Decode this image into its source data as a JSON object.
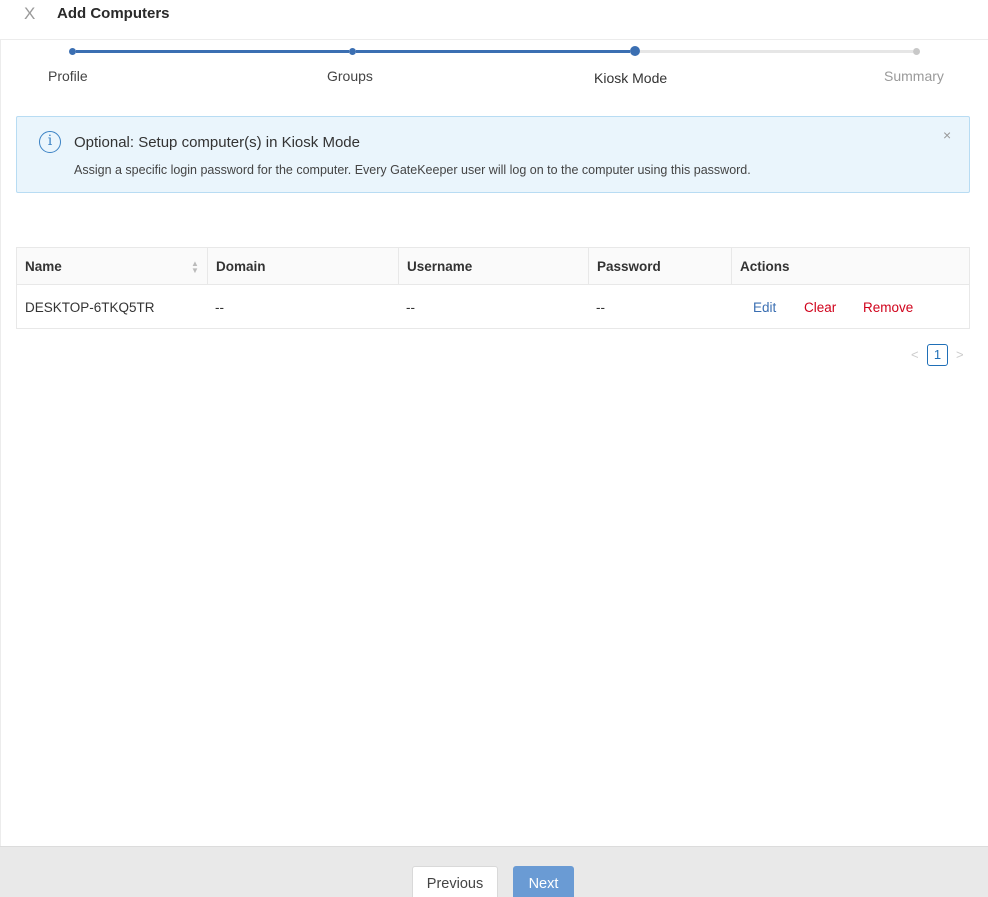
{
  "header": {
    "close_glyph": "X",
    "title": "Add Computers"
  },
  "stepper": {
    "steps": [
      {
        "label": "Profile",
        "state": "done"
      },
      {
        "label": "Groups",
        "state": "done"
      },
      {
        "label": "Kiosk Mode",
        "state": "current"
      },
      {
        "label": "Summary",
        "state": "pending"
      }
    ],
    "colors": {
      "active": "#3b6fb2",
      "inactive": "#e4e4e4",
      "pending_dot": "#c8c8c8",
      "pending_label": "#9a9a9a"
    }
  },
  "alert": {
    "icon": "info-circle-icon",
    "icon_glyph": "i",
    "title": "Optional: Setup computer(s) in Kiosk Mode",
    "description": "Assign a specific login password for the computer. Every GateKeeper user will log on to the computer using this password.",
    "close_glyph": "×"
  },
  "table": {
    "columns": [
      "Name",
      "Domain",
      "Username",
      "Password",
      "Actions"
    ],
    "rows": [
      {
        "name": "DESKTOP-6TKQ5TR",
        "domain": "--",
        "username": "--",
        "password": "--",
        "actions": {
          "edit": "Edit",
          "clear": "Clear",
          "remove": "Remove"
        }
      }
    ],
    "colors": {
      "edit": "#3b6fb2",
      "danger": "#d0021b"
    }
  },
  "pagination": {
    "prev_glyph": "<",
    "current_page": "1",
    "next_glyph": ">"
  },
  "footer": {
    "previous_label": "Previous",
    "next_label": "Next"
  }
}
